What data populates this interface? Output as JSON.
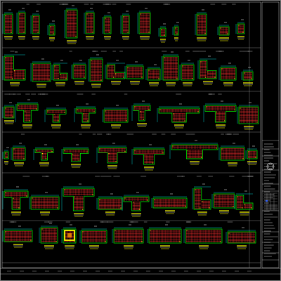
{
  "drawing": {
    "background": "#000000",
    "colors": {
      "frame": "#c8c8c8",
      "outline": "#00ff00",
      "rebar": "#ff3030",
      "dim": "#00ffff",
      "label": "#ffff00",
      "white": "#ffffff",
      "blue": "#3060ff",
      "orange": "#ff9900"
    },
    "row_count": 6,
    "title_block": {
      "seal_label": "design-seal-icon"
    }
  }
}
